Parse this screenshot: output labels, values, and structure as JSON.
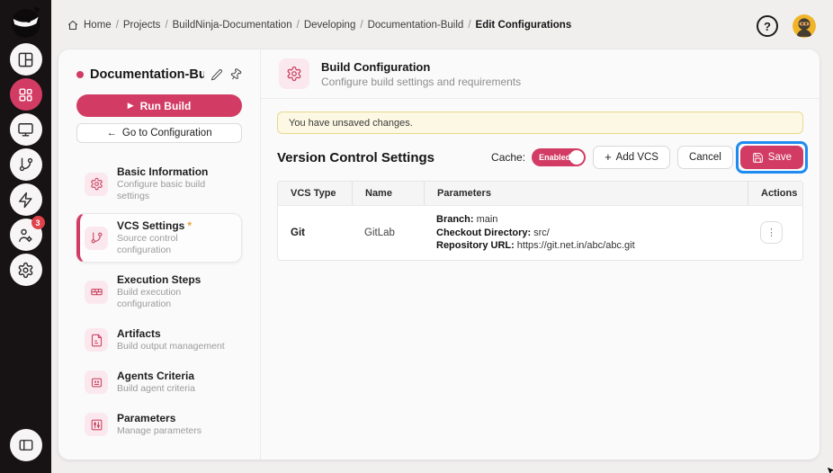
{
  "colors": {
    "primary": "#d23c64",
    "primary_light": "#fbe8ee",
    "rail_bg": "#171213",
    "page_bg": "#f1eeee",
    "banner_bg": "#fcf8e3",
    "banner_border": "#e7d98c",
    "highlight_blue": "#1f8bf0",
    "badge_red": "#e0434b",
    "avatar_bg": "#f0b428"
  },
  "icons": {
    "play": "▶",
    "back_arrow": "←",
    "plus": "+",
    "dots_vertical": "⋮",
    "question": "?"
  },
  "topbar": {
    "breadcrumb": {
      "separator": "/",
      "items": [
        "Home",
        "Projects",
        "BuildNinja-Documentation",
        "Developing",
        "Documentation-Build",
        "Edit Configurations"
      ]
    }
  },
  "rail": {
    "badge_count": "3"
  },
  "project_panel": {
    "title": "Documentation-Bu...",
    "run_build_label": "Run Build",
    "goto_configuration_label": "Go to Configuration",
    "nav": [
      {
        "label": "Basic Information",
        "sublabel": "Configure basic build settings"
      },
      {
        "label": "VCS Settings",
        "required_mark": "*",
        "sublabel": "Source control configuration"
      },
      {
        "label": "Execution Steps",
        "sublabel": "Build execution configuration"
      },
      {
        "label": "Artifacts",
        "sublabel": "Build output management"
      },
      {
        "label": "Agents Criteria",
        "sublabel": "Build agent criteria"
      },
      {
        "label": "Parameters",
        "sublabel": "Manage parameters"
      }
    ]
  },
  "main": {
    "header": {
      "title": "Build Configuration",
      "subtitle": "Configure build settings and requirements"
    },
    "banner_text": "You have unsaved changes.",
    "section_title": "Version Control Settings",
    "cache": {
      "label": "Cache:",
      "state": "Enabled"
    },
    "buttons": {
      "add_vcs": "Add VCS",
      "cancel": "Cancel",
      "save": "Save"
    },
    "table": {
      "headers": [
        "VCS Type",
        "Name",
        "Parameters",
        "Actions"
      ],
      "rows": [
        {
          "vcs_type": "Git",
          "name": "GitLab",
          "parameters": [
            {
              "label": "Branch:",
              "value": "main"
            },
            {
              "label": "Checkout Directory:",
              "value": "src/"
            },
            {
              "label": "Repository URL:",
              "value": "https://git.net.in/abc/abc.git"
            }
          ]
        }
      ]
    }
  }
}
